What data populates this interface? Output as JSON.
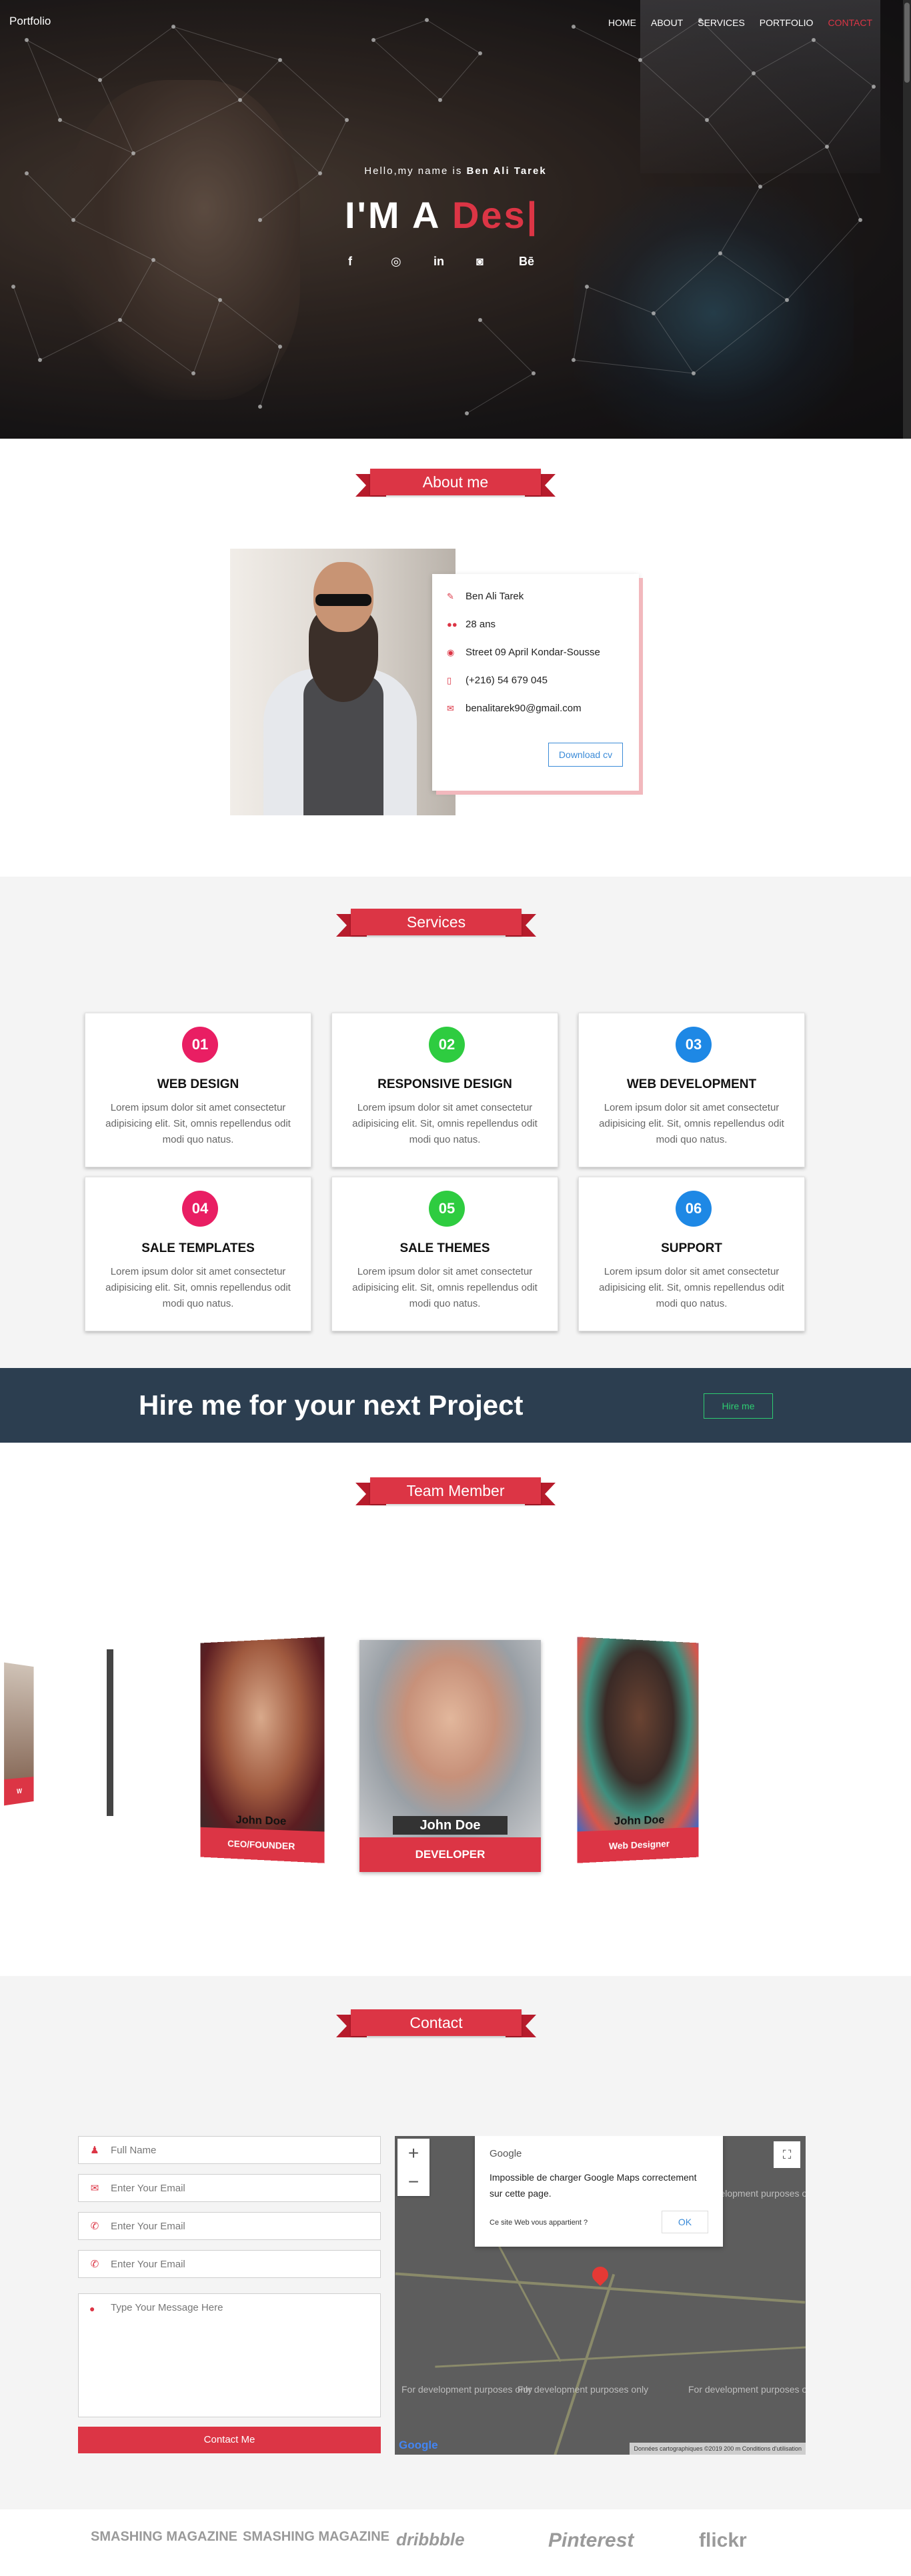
{
  "nav": {
    "brand": "Portfolio",
    "items": [
      "HOME",
      "ABOUT",
      "SERVICES",
      "PORTFOLIO"
    ],
    "extra": "CONTACT"
  },
  "hero": {
    "hello_prefix": "Hello,my name is ",
    "hello_name": "Ben Ali Tarek",
    "title_static": "I'M A ",
    "title_typed": "Des|",
    "socials": [
      "f",
      "◎",
      "in",
      "◙",
      "Bē"
    ]
  },
  "about": {
    "title": "About me",
    "name": "Ben Ali Tarek",
    "age": "28 ans",
    "address": "Street 09 April Kondar-Sousse",
    "phone": "(+216) 54 679 045",
    "email": "benalitarek90@gmail.com",
    "download": "Download cv"
  },
  "services": {
    "title": "Services",
    "items": [
      {
        "num": "01",
        "title": "WEB DESIGN",
        "text": "Lorem ipsum dolor sit amet consectetur adipisicing elit. Sit, omnis repellendus odit modi quo natus.",
        "color": "#e91e63"
      },
      {
        "num": "02",
        "title": "RESPONSIVE DESIGN",
        "text": "Lorem ipsum dolor sit amet consectetur adipisicing elit. Sit, omnis repellendus odit modi quo natus.",
        "color": "#2ecc40"
      },
      {
        "num": "03",
        "title": "WEB DEVELOPMENT",
        "text": "Lorem ipsum dolor sit amet consectetur adipisicing elit. Sit, omnis repellendus odit modi quo natus.",
        "color": "#1e88e5"
      },
      {
        "num": "04",
        "title": "SALE TEMPLATES",
        "text": "Lorem ipsum dolor sit amet consectetur adipisicing elit. Sit, omnis repellendus odit modi quo natus.",
        "color": "#e91e63"
      },
      {
        "num": "05",
        "title": "SALE THEMES",
        "text": "Lorem ipsum dolor sit amet consectetur adipisicing elit. Sit, omnis repellendus odit modi quo natus.",
        "color": "#2ecc40"
      },
      {
        "num": "06",
        "title": "SUPPORT",
        "text": "Lorem ipsum dolor sit amet consectetur adipisicing elit. Sit, omnis repellendus odit modi quo natus.",
        "color": "#1e88e5"
      }
    ]
  },
  "hire": {
    "text": "Hire me for your next Project",
    "button": "Hire me"
  },
  "team": {
    "title": "Team Member",
    "members": [
      {
        "name": "John Doe",
        "role": "CEO/FOUNDER"
      },
      {
        "name": "John Doe",
        "role": "DEVELOPER"
      },
      {
        "name": "John Doe",
        "role": "Web Designer"
      }
    ],
    "edge_label": "w"
  },
  "contact": {
    "title": "Contact",
    "fields": [
      {
        "placeholder": "Full Name",
        "icon": "user-icon"
      },
      {
        "placeholder": "Enter Your Email",
        "icon": "envelope-icon"
      },
      {
        "placeholder": "Enter Your Email",
        "icon": "phone-icon"
      },
      {
        "placeholder": "Enter Your Email",
        "icon": "phone-icon"
      }
    ],
    "message_placeholder": "Type Your Message Here",
    "send": "Contact Me",
    "map": {
      "dialog_title": "Google",
      "dialog_msg": "Impossible de charger Google Maps correctement sur cette page.",
      "dialog_q": "Ce site Web vous appartient ?",
      "dialog_ok": "OK",
      "dev_text": "For development purposes only",
      "logo": "Google",
      "footer": "Données cartographiques ©2019   200 m   Conditions d'utilisation"
    }
  },
  "logos": [
    "SMASHING MAGAZINE",
    "SMASHING MAGAZINE",
    "dribbble",
    "Pinterest",
    "flickr"
  ]
}
